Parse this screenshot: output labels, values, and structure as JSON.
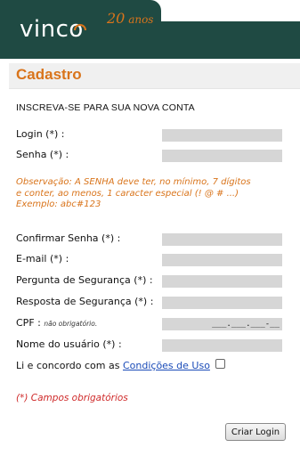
{
  "header": {
    "logo_text": "vinco",
    "tagline_number": "20",
    "tagline_text": "anos"
  },
  "page": {
    "title": "Cadastro",
    "intro": "INSCREVA-SE PARA SUA NOVA CONTA"
  },
  "form": {
    "login_label": "Login (*) :",
    "senha_label": "Senha (*) :",
    "note_line1": "Observação: A SENHA deve ter, no mínimo, 7 dígitos",
    "note_line2": "e conter, ao menos, 1 caracter especial (! @ #  ...)",
    "note_line3": "Exemplo: abc#123",
    "confirmar_label": "Confirmar Senha (*) :",
    "email_label": "E-mail (*) :",
    "pergunta_label": "Pergunta de Segurança (*) :",
    "resposta_label": "Resposta de Segurança (*) :",
    "cpf_label": "CPF :",
    "cpf_hint": "não obrigatório.",
    "cpf_value": "___.___.___-__",
    "nome_label": "Nome do usuário (*) :",
    "terms_text": "Li e concordo com as ",
    "terms_link": "Condições de Uso",
    "required_note": "(*) Campos obrigatórios",
    "submit_label": "Criar Login"
  },
  "colors": {
    "header_green": "#1f4a43",
    "accent_orange": "#d9741b",
    "required_red": "#cf2a2a",
    "link_blue": "#1a4bb8"
  }
}
